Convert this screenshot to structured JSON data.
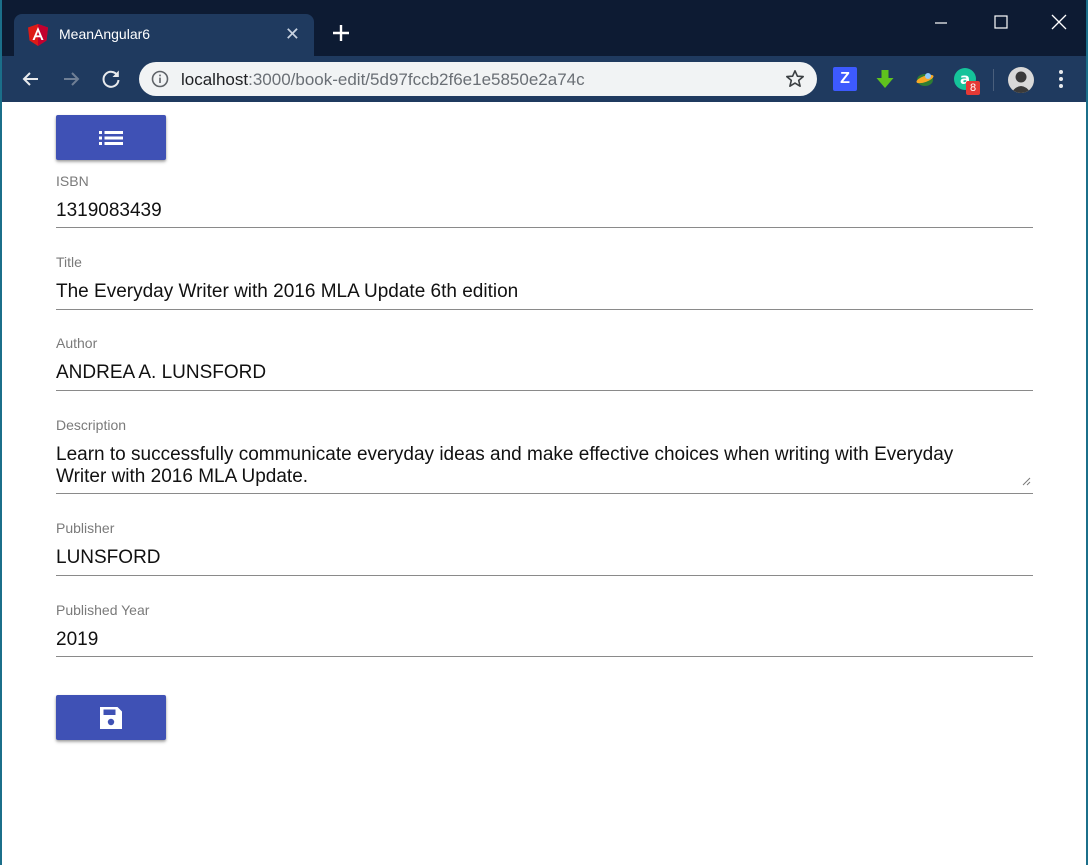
{
  "browser": {
    "tab_title": "MeanAngular6",
    "url_host": "localhost",
    "url_path": ":3000/book-edit/5d97fccb2f6e1e5850e2a74c",
    "extension_badge": "8"
  },
  "form": {
    "isbn": {
      "label": "ISBN",
      "value": "1319083439"
    },
    "title": {
      "label": "Title",
      "value": "The Everyday Writer with 2016 MLA Update 6th edition"
    },
    "author": {
      "label": "Author",
      "value": "ANDREA A. LUNSFORD"
    },
    "description": {
      "label": "Description",
      "value": "Learn to successfully communicate everyday ideas and make effective choices when writing with Everyday\nWriter with 2016 MLA Update."
    },
    "publisher": {
      "label": "Publisher",
      "value": "LUNSFORD"
    },
    "published_year": {
      "label": "Published Year",
      "value": "2019"
    }
  },
  "colors": {
    "primary": "#3f51b5",
    "titlebar": "#0d1b33",
    "toolbar": "#1f3a5f"
  },
  "icons": {
    "list_button": "list-icon",
    "save_button": "save-icon"
  }
}
